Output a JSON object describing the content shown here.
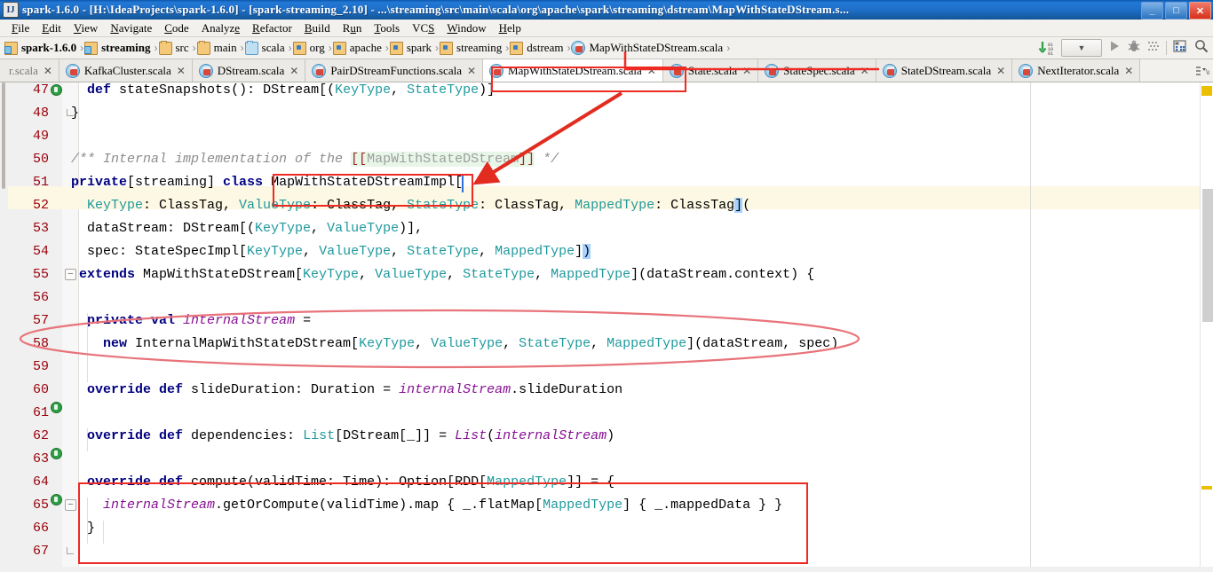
{
  "window": {
    "title": "spark-1.6.0 - [H:\\IdeaProjects\\spark-1.6.0] - [spark-streaming_2.10] - ...\\streaming\\src\\main\\scala\\org\\apache\\spark\\streaming\\dstream\\MapWithStateDStream.s...",
    "app_icon_label": "IJ",
    "buttons": {
      "minimize": "_",
      "maximize": "□",
      "close": "✕"
    }
  },
  "menubar": {
    "items": [
      "File",
      "Edit",
      "View",
      "Navigate",
      "Code",
      "Analyze",
      "Refactor",
      "Build",
      "Run",
      "Tools",
      "VCS",
      "Window",
      "Help"
    ]
  },
  "breadcrumb": {
    "items": [
      {
        "label": "spark-1.6.0",
        "icon": "project-folder-icon",
        "bold": true
      },
      {
        "label": "streaming",
        "icon": "module-folder-icon",
        "bold": true
      },
      {
        "label": "src",
        "icon": "folder-icon",
        "bold": false
      },
      {
        "label": "main",
        "icon": "folder-icon",
        "bold": false
      },
      {
        "label": "scala",
        "icon": "source-folder-icon",
        "bold": false
      },
      {
        "label": "org",
        "icon": "package-icon",
        "bold": false
      },
      {
        "label": "apache",
        "icon": "package-icon",
        "bold": false
      },
      {
        "label": "spark",
        "icon": "package-icon",
        "bold": false
      },
      {
        "label": "streaming",
        "icon": "package-icon",
        "bold": false
      },
      {
        "label": "dstream",
        "icon": "package-icon",
        "bold": false
      },
      {
        "label": "MapWithStateDStream.scala",
        "icon": "scala-file-icon",
        "bold": false
      }
    ],
    "separator": "›",
    "tools": [
      "update-project-icon",
      "run-configuration-dropdown",
      "run-icon",
      "debug-icon",
      "coverage-icon",
      "toggle-layout-icon",
      "search-everywhere-icon"
    ]
  },
  "tabs": [
    {
      "label": "r.scala",
      "active": false,
      "truncated": true
    },
    {
      "label": "KafkaCluster.scala",
      "active": false
    },
    {
      "label": "DStream.scala",
      "active": false
    },
    {
      "label": "PairDStreamFunctions.scala",
      "active": false
    },
    {
      "label": "MapWithStateDStream.scala",
      "active": true
    },
    {
      "label": "State.scala",
      "active": false
    },
    {
      "label": "StateSpec.scala",
      "active": false
    },
    {
      "label": "StateDStream.scala",
      "active": false
    },
    {
      "label": "NextIterator.scala",
      "active": false
    }
  ],
  "tab_close_glyph": "✕",
  "editor": {
    "current_line": 52,
    "first_visible_line": 47,
    "last_visible_line": 67,
    "caret_line": 51,
    "lines": [
      {
        "n": 47,
        "gutter": "implements-down-icon",
        "fold": null
      },
      {
        "n": 48,
        "gutter": null,
        "fold": "fold-end"
      },
      {
        "n": 49,
        "gutter": null,
        "fold": null
      },
      {
        "n": 50,
        "gutter": null,
        "fold": null
      },
      {
        "n": 51,
        "gutter": null,
        "fold": null
      },
      {
        "n": 52,
        "gutter": null,
        "fold": null
      },
      {
        "n": 53,
        "gutter": null,
        "fold": null
      },
      {
        "n": 54,
        "gutter": null,
        "fold": null
      },
      {
        "n": 55,
        "gutter": null,
        "fold": "fold-start"
      },
      {
        "n": 56,
        "gutter": null,
        "fold": null
      },
      {
        "n": 57,
        "gutter": null,
        "fold": null
      },
      {
        "n": 58,
        "gutter": null,
        "fold": null
      },
      {
        "n": 59,
        "gutter": null,
        "fold": null
      },
      {
        "n": 60,
        "gutter": "overrides-up-icon",
        "fold": null
      },
      {
        "n": 61,
        "gutter": null,
        "fold": null
      },
      {
        "n": 62,
        "gutter": "overrides-up-icon",
        "fold": null
      },
      {
        "n": 63,
        "gutter": null,
        "fold": null
      },
      {
        "n": 64,
        "gutter": "overrides-up-icon",
        "fold": "fold-start"
      },
      {
        "n": 65,
        "gutter": null,
        "fold": null
      },
      {
        "n": 66,
        "gutter": null,
        "fold": "fold-end"
      },
      {
        "n": 67,
        "gutter": null,
        "fold": null
      }
    ],
    "code_text": [
      "  def stateSnapshots(): DStream[(KeyType, StateType)]",
      "}",
      "",
      "/** Internal implementation of the [[MapWithStateDStream]] */",
      "private[streaming] class MapWithStateDStreamImpl[",
      "    KeyType: ClassTag, ValueType: ClassTag, StateType: ClassTag, MappedType: ClassTag](",
      "    dataStream: DStream[(KeyType, ValueType)],",
      "    spec: StateSpecImpl[KeyType, ValueType, StateType, MappedType])",
      "  extends MapWithStateDStream[KeyType, ValueType, StateType, MappedType](dataStream.context) {",
      "",
      "  private val internalStream =",
      "    new InternalMapWithStateDStream[KeyType, ValueType, StateType, MappedType](dataStream, spec)",
      "",
      "  override def slideDuration: Duration = internalStream.slideDuration",
      "",
      "  override def dependencies: List[DStream[_]] = List(internalStream)",
      "",
      "  override def compute(validTime: Time): Option[RDD[MappedType]] = {",
      "    internalStream.getOrCompute(validTime).map { _.flatMap[MappedType] { _.mappedData } }",
      "  }",
      ""
    ]
  },
  "annotations": {
    "boxes": [
      {
        "name": "tab-highlight-box",
        "target": "MapWithStateDStream.scala tab"
      },
      {
        "name": "classname-highlight-box",
        "target": "MapWithStateDStreamImpl"
      },
      {
        "name": "compute-method-highlight-box",
        "target": "override def compute"
      },
      {
        "name": "breadcrumb-file-highlight-box",
        "target": "MapWithStateDStream.scala breadcrumb"
      }
    ],
    "ellipse": {
      "name": "internal-stream-highlight-ellipse",
      "target": "private val internalStream"
    },
    "arrow": {
      "name": "tab-to-class-arrow",
      "from": "MapWithStateDStream.scala tab",
      "to": "MapWithStateDStreamImpl"
    }
  },
  "colors": {
    "annotation_red": "#ee2b22",
    "annotation_pink": "#e8737a",
    "title_blue": "#1f6fc8",
    "current_line": "#fdf8e3",
    "keyword": "#000080",
    "type": "#20999d",
    "field": "#871094",
    "comment": "#8c8c8c",
    "linenum": "#99000a",
    "marker_warning": "#ecc000"
  }
}
